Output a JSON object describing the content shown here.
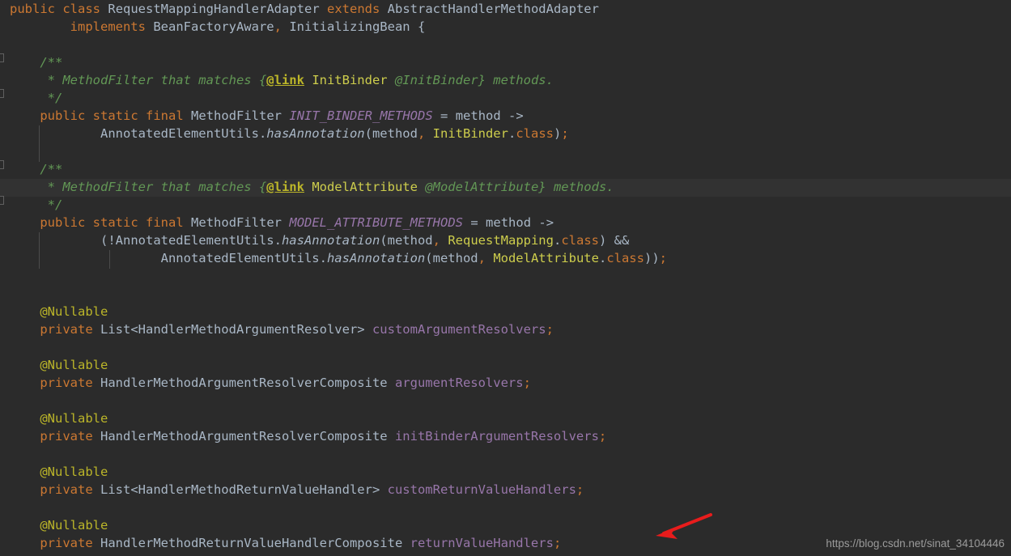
{
  "editor": {
    "background_color": "#2b2b2b",
    "current_line_color": "#323232",
    "language": "java"
  },
  "code": {
    "lines": [
      "public class RequestMappingHandlerAdapter extends AbstractHandlerMethodAdapter",
      "        implements BeanFactoryAware, InitializingBean {",
      "",
      "    /**",
      "     * MethodFilter that matches {@link InitBinder @InitBinder} methods.",
      "     */",
      "    public static final MethodFilter INIT_BINDER_METHODS = method ->",
      "            AnnotatedElementUtils.hasAnnotation(method, InitBinder.class);",
      "",
      "    /**",
      "     * MethodFilter that matches {@link ModelAttribute @ModelAttribute} methods.",
      "     */",
      "    public static final MethodFilter MODEL_ATTRIBUTE_METHODS = method ->",
      "            (!AnnotatedElementUtils.hasAnnotation(method, RequestMapping.class) &&",
      "                    AnnotatedElementUtils.hasAnnotation(method, ModelAttribute.class));",
      "",
      "",
      "    @Nullable",
      "    private List<HandlerMethodArgumentResolver> customArgumentResolvers;",
      "",
      "    @Nullable",
      "    private HandlerMethodArgumentResolverComposite argumentResolvers;",
      "",
      "    @Nullable",
      "    private HandlerMethodArgumentResolverComposite initBinderArgumentResolvers;",
      "",
      "    @Nullable",
      "    private List<HandlerMethodReturnValueHandler> customReturnValueHandlers;",
      "",
      "    @Nullable",
      "    private HandlerMethodReturnValueHandlerComposite returnValueHandlers;"
    ],
    "class_name": "RequestMappingHandlerAdapter",
    "superclass": "AbstractHandlerMethodAdapter",
    "interfaces": [
      "BeanFactoryAware",
      "InitializingBean"
    ],
    "constants": [
      "INIT_BINDER_METHODS",
      "MODEL_ATTRIBUTE_METHODS"
    ],
    "fields": [
      "customArgumentResolvers",
      "argumentResolvers",
      "initBinderArgumentResolvers",
      "customReturnValueHandlers",
      "returnValueHandlers"
    ]
  },
  "annotation": {
    "arrow_color": "#e81c1c",
    "arrow_points_to": "returnValueHandlers"
  },
  "watermark": {
    "text": "https://blog.csdn.net/sinat_34104446",
    "color": "#9b9b9b"
  }
}
